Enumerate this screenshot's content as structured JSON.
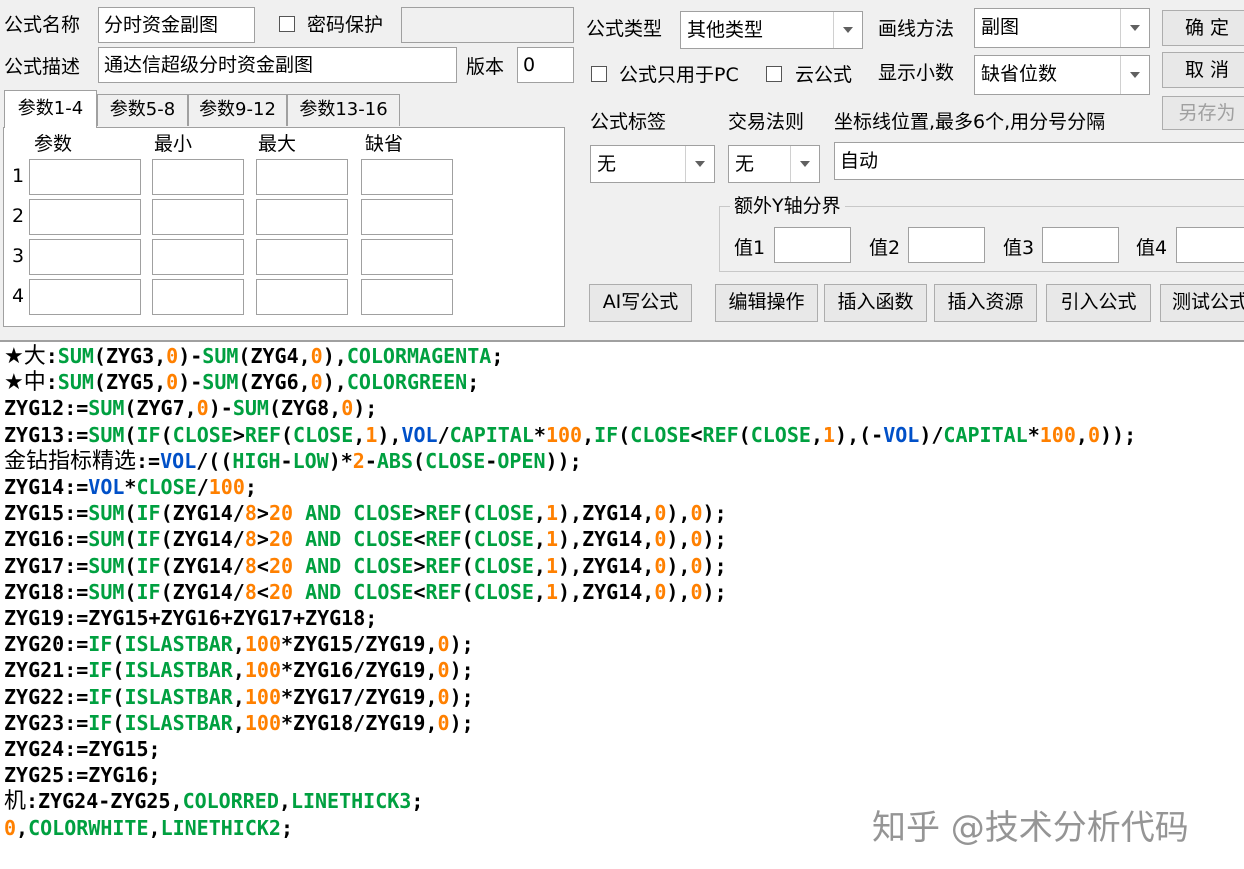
{
  "form": {
    "name_label": "公式名称",
    "name_value": "分时资金副图",
    "password_label": "密码保护",
    "password_value": "",
    "desc_label": "公式描述",
    "desc_value": "通达信超级分时资金副图",
    "version_label": "版本",
    "version_value": "0",
    "type_label": "公式类型",
    "type_value": "其他类型",
    "draw_label": "画线方法",
    "draw_value": "副图",
    "pc_only_label": "公式只用于PC",
    "cloud_label": "云公式",
    "decimals_label": "显示小数",
    "decimals_value": "缺省位数",
    "tag_label": "公式标签",
    "tag_value": "无",
    "trade_label": "交易法则",
    "trade_value": "无",
    "axis_label": "坐标线位置,最多6个,用分号分隔",
    "axis_value": "自动",
    "yaxis_group_label": "额外Y轴分界",
    "yaxis_values": [
      "值1",
      "值2",
      "值3",
      "值4"
    ]
  },
  "buttons": {
    "ok": "确 定",
    "cancel": "取 消",
    "save_as": "另存为",
    "ai": "AI写公式",
    "edit": "编辑操作",
    "insert_func": "插入函数",
    "insert_res": "插入资源",
    "import": "引入公式",
    "test": "测试公式"
  },
  "tabs": [
    "参数1-4",
    "参数5-8",
    "参数9-12",
    "参数13-16"
  ],
  "params": {
    "headers": [
      "参数",
      "最小",
      "最大",
      "缺省"
    ],
    "rows": [
      "1",
      "2",
      "3",
      "4"
    ]
  },
  "code_lines": [
    [
      [
        "t",
        "★大"
      ],
      [
        "v",
        ":"
      ],
      [
        "f",
        "SUM"
      ],
      [
        "v",
        "(ZYG3,"
      ],
      [
        "n",
        "0"
      ],
      [
        "v",
        ")-"
      ],
      [
        "f",
        "SUM"
      ],
      [
        "v",
        "(ZYG4,"
      ],
      [
        "n",
        "0"
      ],
      [
        "v",
        "),"
      ],
      [
        "f",
        "COLORMAGENTA"
      ],
      [
        "v",
        ";"
      ]
    ],
    [
      [
        "t",
        "★中"
      ],
      [
        "v",
        ":"
      ],
      [
        "f",
        "SUM"
      ],
      [
        "v",
        "(ZYG5,"
      ],
      [
        "n",
        "0"
      ],
      [
        "v",
        ")-"
      ],
      [
        "f",
        "SUM"
      ],
      [
        "v",
        "(ZYG6,"
      ],
      [
        "n",
        "0"
      ],
      [
        "v",
        "),"
      ],
      [
        "f",
        "COLORGREEN"
      ],
      [
        "v",
        ";"
      ]
    ],
    [
      [
        "v",
        "ZYG12:="
      ],
      [
        "f",
        "SUM"
      ],
      [
        "v",
        "(ZYG7,"
      ],
      [
        "n",
        "0"
      ],
      [
        "v",
        ")-"
      ],
      [
        "f",
        "SUM"
      ],
      [
        "v",
        "(ZYG8,"
      ],
      [
        "n",
        "0"
      ],
      [
        "v",
        ");"
      ]
    ],
    [
      [
        "v",
        "ZYG13:="
      ],
      [
        "f",
        "SUM"
      ],
      [
        "v",
        "("
      ],
      [
        "f",
        "IF"
      ],
      [
        "v",
        "("
      ],
      [
        "f",
        "CLOSE"
      ],
      [
        "v",
        ">"
      ],
      [
        "f",
        "REF"
      ],
      [
        "v",
        "("
      ],
      [
        "f",
        "CLOSE"
      ],
      [
        "v",
        ","
      ],
      [
        "n",
        "1"
      ],
      [
        "v",
        "),"
      ],
      [
        "k",
        "VOL"
      ],
      [
        "v",
        "/"
      ],
      [
        "f",
        "CAPITAL"
      ],
      [
        "v",
        "*"
      ],
      [
        "n",
        "100"
      ],
      [
        "v",
        ","
      ],
      [
        "f",
        "IF"
      ],
      [
        "v",
        "("
      ],
      [
        "f",
        "CLOSE"
      ],
      [
        "v",
        "<"
      ],
      [
        "f",
        "REF"
      ],
      [
        "v",
        "("
      ],
      [
        "f",
        "CLOSE"
      ],
      [
        "v",
        ","
      ],
      [
        "n",
        "1"
      ],
      [
        "v",
        "),(-"
      ],
      [
        "k",
        "VOL"
      ],
      [
        "v",
        ")/"
      ],
      [
        "f",
        "CAPITAL"
      ],
      [
        "v",
        "*"
      ],
      [
        "n",
        "100"
      ],
      [
        "v",
        ","
      ],
      [
        "n",
        "0"
      ],
      [
        "v",
        "));"
      ]
    ],
    [
      [
        "t",
        "金钻指标精选"
      ],
      [
        "v",
        ":="
      ],
      [
        "k",
        "VOL"
      ],
      [
        "v",
        "/(("
      ],
      [
        "f",
        "HIGH"
      ],
      [
        "v",
        "-"
      ],
      [
        "f",
        "LOW"
      ],
      [
        "v",
        ")*"
      ],
      [
        "n",
        "2"
      ],
      [
        "v",
        "-"
      ],
      [
        "f",
        "ABS"
      ],
      [
        "v",
        "("
      ],
      [
        "f",
        "CLOSE"
      ],
      [
        "v",
        "-"
      ],
      [
        "f",
        "OPEN"
      ],
      [
        "v",
        "));"
      ]
    ],
    [
      [
        "v",
        "ZYG14:="
      ],
      [
        "k",
        "VOL"
      ],
      [
        "v",
        "*"
      ],
      [
        "f",
        "CLOSE"
      ],
      [
        "v",
        "/"
      ],
      [
        "n",
        "100"
      ],
      [
        "v",
        ";"
      ]
    ],
    [
      [
        "v",
        "ZYG15:="
      ],
      [
        "f",
        "SUM"
      ],
      [
        "v",
        "("
      ],
      [
        "f",
        "IF"
      ],
      [
        "v",
        "(ZYG14/"
      ],
      [
        "n",
        "8"
      ],
      [
        "v",
        ">"
      ],
      [
        "n",
        "20"
      ],
      [
        "v",
        " "
      ],
      [
        "f",
        "AND"
      ],
      [
        "v",
        " "
      ],
      [
        "f",
        "CLOSE"
      ],
      [
        "v",
        ">"
      ],
      [
        "f",
        "REF"
      ],
      [
        "v",
        "("
      ],
      [
        "f",
        "CLOSE"
      ],
      [
        "v",
        ","
      ],
      [
        "n",
        "1"
      ],
      [
        "v",
        "),ZYG14,"
      ],
      [
        "n",
        "0"
      ],
      [
        "v",
        "),"
      ],
      [
        "n",
        "0"
      ],
      [
        "v",
        ");"
      ]
    ],
    [
      [
        "v",
        "ZYG16:="
      ],
      [
        "f",
        "SUM"
      ],
      [
        "v",
        "("
      ],
      [
        "f",
        "IF"
      ],
      [
        "v",
        "(ZYG14/"
      ],
      [
        "n",
        "8"
      ],
      [
        "v",
        ">"
      ],
      [
        "n",
        "20"
      ],
      [
        "v",
        " "
      ],
      [
        "f",
        "AND"
      ],
      [
        "v",
        " "
      ],
      [
        "f",
        "CLOSE"
      ],
      [
        "v",
        "<"
      ],
      [
        "f",
        "REF"
      ],
      [
        "v",
        "("
      ],
      [
        "f",
        "CLOSE"
      ],
      [
        "v",
        ","
      ],
      [
        "n",
        "1"
      ],
      [
        "v",
        "),ZYG14,"
      ],
      [
        "n",
        "0"
      ],
      [
        "v",
        "),"
      ],
      [
        "n",
        "0"
      ],
      [
        "v",
        ");"
      ]
    ],
    [
      [
        "v",
        "ZYG17:="
      ],
      [
        "f",
        "SUM"
      ],
      [
        "v",
        "("
      ],
      [
        "f",
        "IF"
      ],
      [
        "v",
        "(ZYG14/"
      ],
      [
        "n",
        "8"
      ],
      [
        "v",
        "<"
      ],
      [
        "n",
        "20"
      ],
      [
        "v",
        " "
      ],
      [
        "f",
        "AND"
      ],
      [
        "v",
        " "
      ],
      [
        "f",
        "CLOSE"
      ],
      [
        "v",
        ">"
      ],
      [
        "f",
        "REF"
      ],
      [
        "v",
        "("
      ],
      [
        "f",
        "CLOSE"
      ],
      [
        "v",
        ","
      ],
      [
        "n",
        "1"
      ],
      [
        "v",
        "),ZYG14,"
      ],
      [
        "n",
        "0"
      ],
      [
        "v",
        "),"
      ],
      [
        "n",
        "0"
      ],
      [
        "v",
        ");"
      ]
    ],
    [
      [
        "v",
        "ZYG18:="
      ],
      [
        "f",
        "SUM"
      ],
      [
        "v",
        "("
      ],
      [
        "f",
        "IF"
      ],
      [
        "v",
        "(ZYG14/"
      ],
      [
        "n",
        "8"
      ],
      [
        "v",
        "<"
      ],
      [
        "n",
        "20"
      ],
      [
        "v",
        " "
      ],
      [
        "f",
        "AND"
      ],
      [
        "v",
        " "
      ],
      [
        "f",
        "CLOSE"
      ],
      [
        "v",
        "<"
      ],
      [
        "f",
        "REF"
      ],
      [
        "v",
        "("
      ],
      [
        "f",
        "CLOSE"
      ],
      [
        "v",
        ","
      ],
      [
        "n",
        "1"
      ],
      [
        "v",
        "),ZYG14,"
      ],
      [
        "n",
        "0"
      ],
      [
        "v",
        "),"
      ],
      [
        "n",
        "0"
      ],
      [
        "v",
        ");"
      ]
    ],
    [
      [
        "v",
        "ZYG19:=ZYG15+ZYG16+ZYG17+ZYG18;"
      ]
    ],
    [
      [
        "v",
        "ZYG20:="
      ],
      [
        "f",
        "IF"
      ],
      [
        "v",
        "("
      ],
      [
        "f",
        "ISLASTBAR"
      ],
      [
        "v",
        ","
      ],
      [
        "n",
        "100"
      ],
      [
        "v",
        "*ZYG15/ZYG19,"
      ],
      [
        "n",
        "0"
      ],
      [
        "v",
        ");"
      ]
    ],
    [
      [
        "v",
        "ZYG21:="
      ],
      [
        "f",
        "IF"
      ],
      [
        "v",
        "("
      ],
      [
        "f",
        "ISLASTBAR"
      ],
      [
        "v",
        ","
      ],
      [
        "n",
        "100"
      ],
      [
        "v",
        "*ZYG16/ZYG19,"
      ],
      [
        "n",
        "0"
      ],
      [
        "v",
        ");"
      ]
    ],
    [
      [
        "v",
        "ZYG22:="
      ],
      [
        "f",
        "IF"
      ],
      [
        "v",
        "("
      ],
      [
        "f",
        "ISLASTBAR"
      ],
      [
        "v",
        ","
      ],
      [
        "n",
        "100"
      ],
      [
        "v",
        "*ZYG17/ZYG19,"
      ],
      [
        "n",
        "0"
      ],
      [
        "v",
        ");"
      ]
    ],
    [
      [
        "v",
        "ZYG23:="
      ],
      [
        "f",
        "IF"
      ],
      [
        "v",
        "("
      ],
      [
        "f",
        "ISLASTBAR"
      ],
      [
        "v",
        ","
      ],
      [
        "n",
        "100"
      ],
      [
        "v",
        "*ZYG18/ZYG19,"
      ],
      [
        "n",
        "0"
      ],
      [
        "v",
        ");"
      ]
    ],
    [
      [
        "v",
        "ZYG24:=ZYG15;"
      ]
    ],
    [
      [
        "v",
        "ZYG25:=ZYG16;"
      ]
    ],
    [
      [
        "t",
        "机"
      ],
      [
        "v",
        ":ZYG24-ZYG25,"
      ],
      [
        "f",
        "COLORRED"
      ],
      [
        "v",
        ","
      ],
      [
        "f",
        "LINETHICK3"
      ],
      [
        "v",
        ";"
      ]
    ],
    [
      [
        "n",
        "0"
      ],
      [
        "v",
        ","
      ],
      [
        "f",
        "COLORWHITE"
      ],
      [
        "v",
        ","
      ],
      [
        "f",
        "LINETHICK2"
      ],
      [
        "v",
        ";"
      ]
    ]
  ],
  "watermark": "知乎 @技术分析代码"
}
